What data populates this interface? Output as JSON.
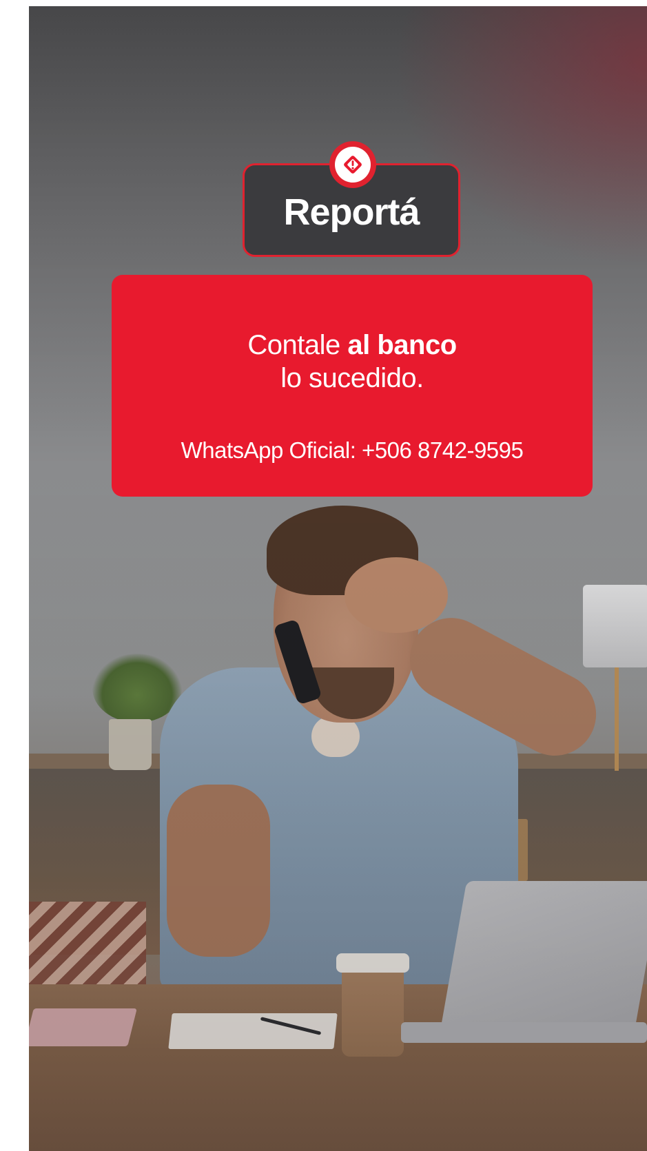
{
  "badge": {
    "title": "Reportá",
    "icon": "alert-diamond-icon"
  },
  "card": {
    "line1_prefix": "Contale ",
    "line1_bold": "al banco",
    "line2": "lo sucedido.",
    "contact": "WhatsApp Oficial: +506 8742-9595"
  },
  "colors": {
    "accent_red": "#e81a2e",
    "badge_dark": "#3b3b3e",
    "text": "#ffffff"
  }
}
